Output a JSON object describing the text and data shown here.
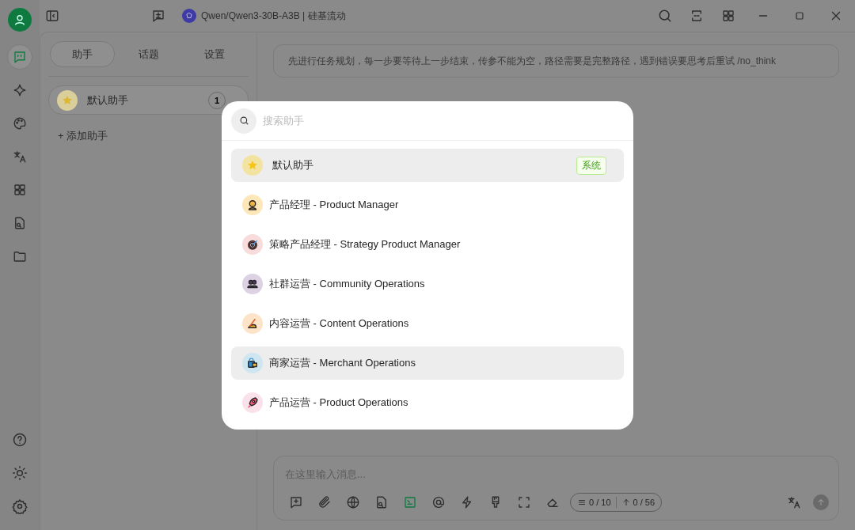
{
  "title_bar": {
    "model_name": "Qwen/Qwen3-30B-A3B | 硅基流动"
  },
  "nav_rail": {
    "items": [
      {
        "kind": "chat",
        "selected": true
      },
      {
        "kind": "sparkle",
        "selected": false
      },
      {
        "kind": "palette",
        "selected": false
      },
      {
        "kind": "translate",
        "selected": false
      },
      {
        "kind": "apps",
        "selected": false
      },
      {
        "kind": "file-search",
        "selected": false
      },
      {
        "kind": "folder",
        "selected": false
      }
    ],
    "bottom_items": [
      {
        "kind": "help"
      },
      {
        "kind": "sun"
      },
      {
        "kind": "settings"
      }
    ]
  },
  "assistant_panel": {
    "tabs": [
      {
        "label": "助手",
        "selected": true
      },
      {
        "label": "话题",
        "selected": false
      },
      {
        "label": "设置",
        "selected": false
      }
    ],
    "assistants": [
      {
        "kind": "star",
        "name": "默认助手",
        "count": "1",
        "selected": true
      }
    ],
    "add_button": "+ 添加助手"
  },
  "prompt_bar": {
    "text": "先进行任务规划，每一步要等待上一步结束，传参不能为空，路径需要是完整路径，遇到错误要思考后重试 /no_think"
  },
  "message_input": {
    "placeholder": "在这里输入消息...",
    "knowledge_count": "0 / 10",
    "token_count": "0 / 56"
  },
  "dialog": {
    "search": {
      "placeholder": "搜索助手"
    },
    "items": [
      {
        "kind": "star",
        "name": "默认助手",
        "tag": "系统",
        "highlighted": true
      },
      {
        "kind": "person",
        "name": "产品经理 - Product Manager",
        "highlighted": false
      },
      {
        "kind": "target",
        "name": "策略产品经理 - Strategy Product Manager",
        "highlighted": false
      },
      {
        "kind": "group",
        "name": "社群运营 - Community Operations",
        "highlighted": false
      },
      {
        "kind": "pencil",
        "name": "内容运营 - Content Operations",
        "highlighted": false
      },
      {
        "kind": "bag",
        "name": "商家运营 - Merchant Operations",
        "highlighted": true
      },
      {
        "kind": "rocket",
        "name": "产品运营 - Product Operations",
        "highlighted": false
      }
    ]
  }
}
